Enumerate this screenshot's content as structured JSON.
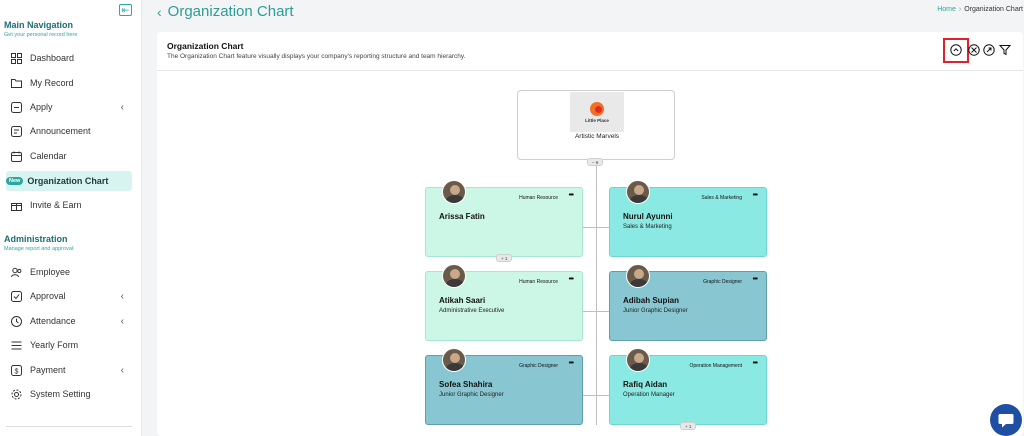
{
  "sidebar": {
    "main_title": "Main Navigation",
    "main_subtitle": "Get your personal record here",
    "items": [
      {
        "label": "Dashboard"
      },
      {
        "label": "My Record"
      },
      {
        "label": "Apply"
      },
      {
        "label": "Announcement"
      },
      {
        "label": "Calendar"
      },
      {
        "label": "Organization Chart",
        "badge": "New"
      },
      {
        "label": "Invite & Earn"
      }
    ],
    "admin_title": "Administration",
    "admin_subtitle": "Manage report and approval",
    "admin_items": [
      {
        "label": "Employee"
      },
      {
        "label": "Approval"
      },
      {
        "label": "Attendance"
      },
      {
        "label": "Yearly Form"
      },
      {
        "label": "Payment"
      },
      {
        "label": "System Setting"
      }
    ]
  },
  "header": {
    "title": "Organization Chart",
    "breadcrumb_home": "Home",
    "breadcrumb_current": "Organization Chart"
  },
  "card": {
    "title": "Organization Chart",
    "description": "The Organization Chart feature visually displays your company's reporting structure and team hierarchy."
  },
  "org": {
    "root": {
      "name": "Artistic Marvels",
      "logo_text": "Little Place",
      "count": "− 6"
    },
    "employees": [
      {
        "name": "Arissa Fatin",
        "department": "Human Resource",
        "role": "",
        "more": "•••",
        "count": "+ 1"
      },
      {
        "name": "Atikah Saari",
        "department": "Human Resource",
        "role": "Administrative Executive",
        "more": "•••"
      },
      {
        "name": "Sofea Shahira",
        "department": "Graphic Designer",
        "role": "Junior Graphic Designer",
        "more": "•••"
      },
      {
        "name": "Nurul Ayunni",
        "department": "Sales & Marketing",
        "role": "Sales & Marketing",
        "more": "•••"
      },
      {
        "name": "Adibah Supian",
        "department": "Graphic Designer",
        "role": "Junior Graphic Designer",
        "more": "•••"
      },
      {
        "name": "Rafiq Aidan",
        "department": "Operation Management",
        "role": "Operation Manager",
        "more": "•••",
        "count": "+ 1"
      }
    ]
  },
  "colors": {
    "accent": "#2aa8a0",
    "highlight": "#e0202a",
    "chat": "#1f4fa3"
  }
}
